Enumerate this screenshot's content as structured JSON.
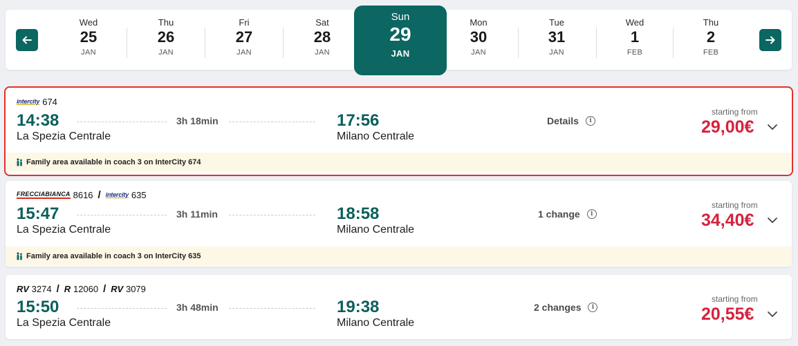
{
  "date_bar": {
    "days": [
      {
        "dow": "Wed",
        "num": "25",
        "mon": "JAN"
      },
      {
        "dow": "Thu",
        "num": "26",
        "mon": "JAN"
      },
      {
        "dow": "Fri",
        "num": "27",
        "mon": "JAN"
      },
      {
        "dow": "Sat",
        "num": "28",
        "mon": "JAN"
      },
      {
        "dow": "Sun",
        "num": "29",
        "mon": "JAN",
        "selected": true
      },
      {
        "dow": "Mon",
        "num": "30",
        "mon": "JAN"
      },
      {
        "dow": "Tue",
        "num": "31",
        "mon": "JAN"
      },
      {
        "dow": "Wed",
        "num": "1",
        "mon": "FEB"
      },
      {
        "dow": "Thu",
        "num": "2",
        "mon": "FEB"
      }
    ],
    "prev_icon": "arrow-left-icon",
    "next_icon": "arrow-right-icon"
  },
  "results": [
    {
      "trains": [
        {
          "brand": "intercity",
          "number": "674"
        }
      ],
      "dep_time": "14:38",
      "dep_station": "La Spezia Centrale",
      "duration": "3h 18min",
      "arr_time": "17:56",
      "arr_station": "Milano Centrale",
      "changes": "Details",
      "from_label": "starting from",
      "price": "29,00€",
      "notice": "Family area available in coach 3 on InterCity 674",
      "highlighted": true
    },
    {
      "trains": [
        {
          "brand": "FRECCIABIANCA",
          "number": "8616"
        },
        {
          "brand": "intercity",
          "number": "635"
        }
      ],
      "dep_time": "15:47",
      "dep_station": "La Spezia Centrale",
      "duration": "3h 11min",
      "arr_time": "18:58",
      "arr_station": "Milano Centrale",
      "changes": "1 change",
      "from_label": "starting from",
      "price": "34,40€",
      "notice": "Family area available in coach 3 on InterCity 635"
    },
    {
      "trains": [
        {
          "brand": "RV",
          "number": "3274"
        },
        {
          "brand": "R",
          "number": "12060"
        },
        {
          "brand": "RV",
          "number": "3079"
        }
      ],
      "dep_time": "15:50",
      "dep_station": "La Spezia Centrale",
      "duration": "3h 48min",
      "arr_time": "19:38",
      "arr_station": "Milano Centrale",
      "changes": "2 changes",
      "from_label": "starting from",
      "price": "20,55€"
    }
  ],
  "colors": {
    "accent": "#0c6661",
    "price": "#d6223d",
    "highlight": "#e0312b",
    "notice_bg": "#fdf7e6"
  }
}
